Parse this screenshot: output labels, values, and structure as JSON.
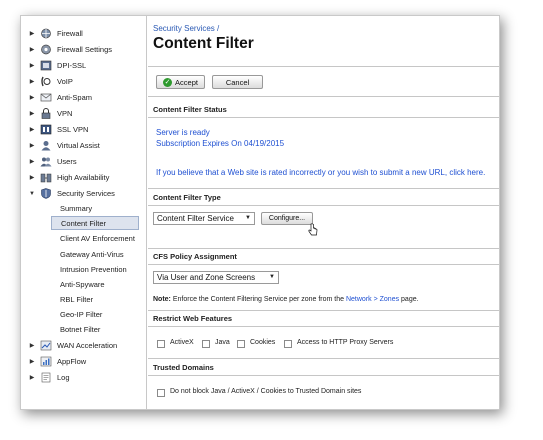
{
  "sidebar": {
    "items_top": [
      {
        "label": "Firewall",
        "icon": "firewall-icon"
      },
      {
        "label": "Firewall Settings",
        "icon": "firewall-settings-icon"
      },
      {
        "label": "DPI-SSL",
        "icon": "dpi-ssl-icon"
      },
      {
        "label": "VoIP",
        "icon": "voip-icon"
      },
      {
        "label": "Anti-Spam",
        "icon": "anti-spam-icon"
      },
      {
        "label": "VPN",
        "icon": "vpn-icon"
      },
      {
        "label": "SSL VPN",
        "icon": "ssl-vpn-icon"
      },
      {
        "label": "Virtual Assist",
        "icon": "virtual-assist-icon"
      },
      {
        "label": "Users",
        "icon": "users-icon"
      },
      {
        "label": "High Availability",
        "icon": "high-availability-icon"
      },
      {
        "label": "Security Services",
        "icon": "security-services-icon"
      }
    ],
    "sub_items": [
      {
        "label": "Summary"
      },
      {
        "label": "Content Filter",
        "selected": true
      },
      {
        "label": "Client AV Enforcement"
      },
      {
        "label": "Gateway Anti-Virus"
      },
      {
        "label": "Intrusion Prevention"
      },
      {
        "label": "Anti-Spyware"
      },
      {
        "label": "RBL Filter"
      },
      {
        "label": "Geo-IP Filter"
      },
      {
        "label": "Botnet Filter"
      }
    ],
    "items_bottom": [
      {
        "label": "WAN Acceleration",
        "icon": "wan-acceleration-icon"
      },
      {
        "label": "AppFlow",
        "icon": "appflow-icon"
      },
      {
        "label": "Log",
        "icon": "log-icon"
      }
    ]
  },
  "header": {
    "breadcrumb": "Security Services /",
    "title": "Content Filter"
  },
  "toolbar": {
    "accept_label": "Accept",
    "cancel_label": "Cancel"
  },
  "status": {
    "heading": "Content Filter Status",
    "line1": "Server is ready",
    "line2": "Subscription Expires On 04/19/2015",
    "report_text": "If you believe that a Web site is rated incorrectly or you wish to submit a new URL, click here."
  },
  "filter_type": {
    "heading": "Content Filter Type",
    "selected": "Content Filter Service",
    "configure_label": "Configure..."
  },
  "policy": {
    "heading": "CFS Policy Assignment",
    "selected": "Via User and Zone Screens",
    "note_prefix": "Note:",
    "note_text": " Enforce the Content Filtering Service per zone from the ",
    "note_link": "Network > Zones",
    "note_suffix": " page."
  },
  "restrict": {
    "heading": "Restrict Web Features",
    "options": [
      "ActiveX",
      "Java",
      "Cookies",
      "Access to HTTP Proxy Servers"
    ]
  },
  "trusted": {
    "heading": "Trusted Domains",
    "option": "Do not block Java / ActiveX / Cookies to Trusted Domain sites"
  },
  "colors": {
    "link": "#1f50d2",
    "selected_bg": "#dde3ee"
  }
}
